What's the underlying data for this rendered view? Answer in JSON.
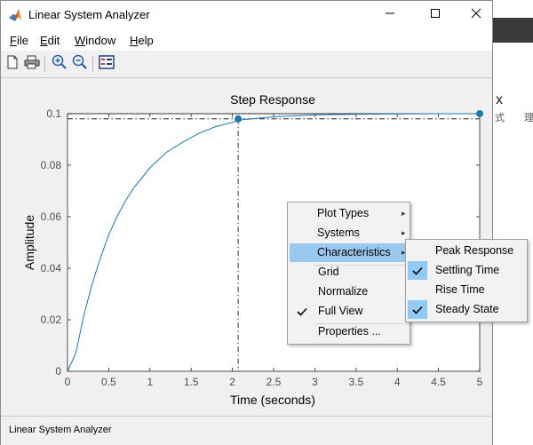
{
  "window": {
    "title": "Linear System Analyzer",
    "controls": {
      "minimize": "minimize",
      "maximize": "maximize",
      "close": "close"
    }
  },
  "menu": {
    "file": {
      "mnemonic": "F",
      "rest": "ile"
    },
    "edit": {
      "mnemonic": "E",
      "rest": "dit"
    },
    "window": {
      "mnemonic": "W",
      "rest": "indow"
    },
    "help": {
      "mnemonic": "H",
      "rest": "elp"
    }
  },
  "toolbar": {
    "icons": [
      "new-icon",
      "print-icon",
      "zoom-in-icon",
      "zoom-out-icon",
      "grid-view-icon"
    ]
  },
  "plot": {
    "title": "Step Response",
    "xlabel": "Time (seconds)",
    "ylabel": "Amplitude",
    "line_color": "#1f77b4",
    "x_ticks": [
      "0",
      "0.5",
      "1",
      "1.5",
      "2",
      "2.5",
      "3",
      "3.5",
      "4",
      "4.5",
      "5"
    ],
    "y_ticks": [
      "0",
      "0.02",
      "0.04",
      "0.06",
      "0.08",
      "0.1"
    ]
  },
  "chart_data": {
    "type": "line",
    "title": "Step Response",
    "xlabel": "Time (seconds)",
    "ylabel": "Amplitude",
    "xlim": [
      0,
      5
    ],
    "ylim": [
      0,
      0.1
    ],
    "grid": false,
    "series": [
      {
        "x": [
          0,
          0.1,
          0.2,
          0.3,
          0.4,
          0.5,
          0.6,
          0.7,
          0.8,
          0.9,
          1.0,
          1.2,
          1.4,
          1.6,
          1.8,
          2.0,
          2.07,
          2.5,
          3.0,
          3.5,
          4.0,
          4.5,
          5.0
        ],
        "values": [
          0,
          0.007,
          0.022,
          0.034,
          0.044,
          0.053,
          0.06,
          0.066,
          0.071,
          0.075,
          0.079,
          0.085,
          0.089,
          0.0925,
          0.095,
          0.0967,
          0.0975,
          0.0988,
          0.0995,
          0.0998,
          0.0999,
          0.1,
          0.1
        ]
      }
    ],
    "markers": [
      {
        "name": "settling-time",
        "x": 2.07,
        "y": 0.098
      },
      {
        "name": "steady-state",
        "x": 5.0,
        "y": 0.1
      }
    ],
    "reference_lines": {
      "settling_band": 0.098,
      "steady_state": 0.1
    }
  },
  "context_menu": {
    "items": [
      {
        "label": "Plot Types",
        "submenu": true,
        "checked": false,
        "highlighted": false
      },
      {
        "label": "Systems",
        "submenu": true,
        "checked": false,
        "highlighted": false
      },
      {
        "label": "Characteristics",
        "submenu": true,
        "checked": false,
        "highlighted": true
      },
      {
        "label": "Grid",
        "submenu": false,
        "checked": false,
        "highlighted": false
      },
      {
        "label": "Normalize",
        "submenu": false,
        "checked": false,
        "highlighted": false
      },
      {
        "label": "Full View",
        "submenu": false,
        "checked": true,
        "highlighted": false
      },
      {
        "label": "Properties ...",
        "submenu": false,
        "checked": false,
        "highlighted": false
      }
    ]
  },
  "characteristics_submenu": {
    "items": [
      {
        "label": "Peak Response",
        "checked": false
      },
      {
        "label": "Settling Time",
        "checked": true
      },
      {
        "label": "Rise Time",
        "checked": false
      },
      {
        "label": "Steady State",
        "checked": true
      }
    ]
  },
  "status": {
    "text": "Linear System Analyzer"
  },
  "background": {
    "glyph_x": "x",
    "glyph_a": "式",
    "glyph_b": "理"
  },
  "colors": {
    "menu_highlight": "#99c9ef",
    "check_box": "#91c9f7",
    "accent": "#1f77b4"
  }
}
